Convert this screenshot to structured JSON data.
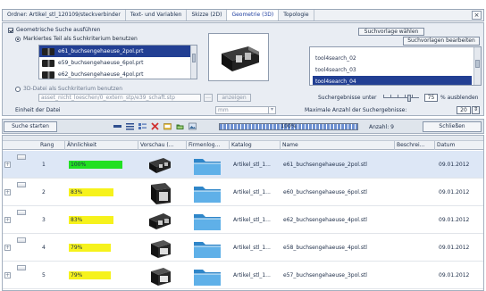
{
  "tabs": [
    {
      "label": "Ordner: Artikel_stl_120109/steckverbinder",
      "active": false
    },
    {
      "label": "Text- und Variablen",
      "active": false
    },
    {
      "label": "Skizze (2D)",
      "active": false
    },
    {
      "label": "Geometrie (3D)",
      "active": true
    },
    {
      "label": "Topologie",
      "active": false
    }
  ],
  "tab_close": "×",
  "geometry": {
    "run_label": "Geometrische Suche ausführen",
    "marked_label": "Markiertes Teil als Suchkriterium benutzen",
    "files": [
      {
        "name": "e61_buchsengehaeuse_2pol.prt",
        "selected": true
      },
      {
        "name": "e59_buchsengehaeuse_6pol.prt",
        "selected": false
      },
      {
        "name": "e62_buchsengehaeuse_4pol.prt",
        "selected": false
      }
    ],
    "template_button": "Suchvorlage wählen",
    "template_edit_button": "Suchvorlagen bearbeiten",
    "templates": [
      {
        "name": "tool4search_02",
        "selected": false
      },
      {
        "name": "tool4search_03",
        "selected": false
      },
      {
        "name": "tool4search_04",
        "selected": true
      }
    ],
    "file3d_label": "3D-Datei als Suchkriterium benutzen",
    "file3d_path": "asset_nicht_loeschen/0_extern_stp/e39_schaft.stp",
    "show_button": "anzeigen",
    "unit_label": "Einheit der Datei",
    "unit_value": "mm",
    "results_below_label": "Suchergebnisse unter",
    "results_below_value": "75",
    "results_hide_label": "% ausblenden",
    "max_results_label": "Maximale Anzahl der Suchergebnisse:",
    "max_results_value": "20"
  },
  "toolbar": {
    "start_label": "Suche starten",
    "progress": 1.0,
    "progress_label": "100%",
    "count_label": "Anzahl: 9",
    "close_label": "Schließen"
  },
  "columns": [
    "Rang",
    "Ähnlichkeit",
    "Vorschau (...",
    "Firmenlog...",
    "Katalog",
    "Name",
    "Beschrei...",
    "Datum"
  ],
  "rows": [
    {
      "rang": "1",
      "similarity": "100%",
      "sim_value": 1.0,
      "color": "#22e022",
      "catalog": "Artikel_stl_1...",
      "name": "e61_buchsengehaeuse_2pol.stl",
      "date": "09.01.2012"
    },
    {
      "rang": "2",
      "similarity": "83%",
      "sim_value": 0.83,
      "color": "#f6f21c",
      "catalog": "Artikel_stl_1...",
      "name": "e60_buchsengehaeuse_6pol.stl",
      "date": "09.01.2012"
    },
    {
      "rang": "3",
      "similarity": "83%",
      "sim_value": 0.83,
      "color": "#f6f21c",
      "catalog": "Artikel_stl_1...",
      "name": "e62_buchsengehaeuse_4pol.stl",
      "date": "09.01.2012"
    },
    {
      "rang": "4",
      "similarity": "79%",
      "sim_value": 0.79,
      "color": "#f6f21c",
      "catalog": "Artikel_stl_1...",
      "name": "e58_buchsengehaeuse_4pol.stl",
      "date": "09.01.2012"
    },
    {
      "rang": "5",
      "similarity": "79%",
      "sim_value": 0.79,
      "color": "#f6f21c",
      "catalog": "Artikel_stl_1...",
      "name": "e57_buchsengehaeuse_3pol.stl",
      "date": "09.01.2012"
    }
  ]
}
